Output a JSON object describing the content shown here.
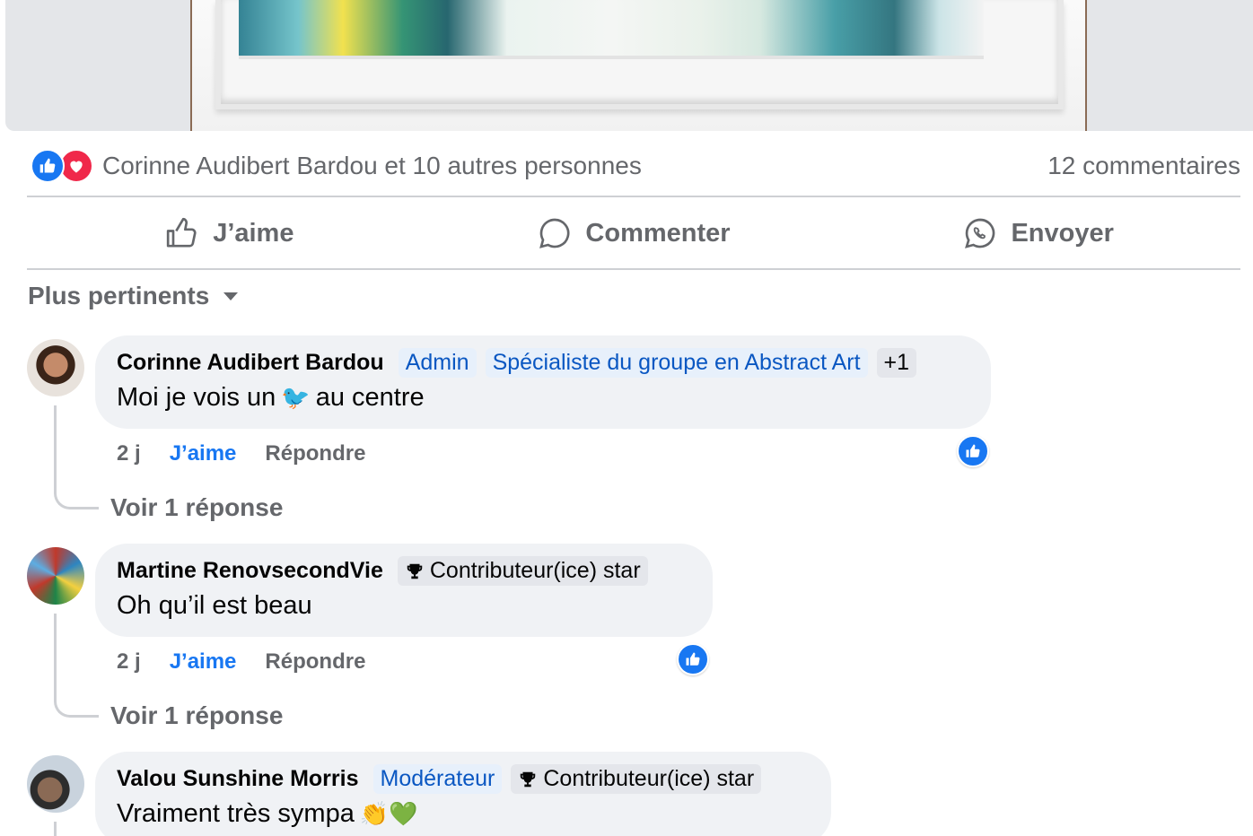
{
  "reactions_summary": {
    "names_text": "Corinne Audibert Bardou et 10 autres personnes",
    "comments_count": "12 commentaires",
    "icons": [
      "like-icon",
      "love-icon"
    ]
  },
  "actions": {
    "like": "J’aime",
    "comment": "Commenter",
    "send": "Envoyer"
  },
  "sort": {
    "label": "Plus pertinents"
  },
  "comments": [
    {
      "author": "Corinne Audibert Bardou",
      "badges": [
        "Admin",
        "Spécialiste du groupe en Abstract Art"
      ],
      "extra_badge": "+1",
      "text_before": "Moi je vois un",
      "emoji": "🐦",
      "text_after": "au centre",
      "time": "2 j",
      "like_label": "J’aime",
      "reply_label": "Répondre",
      "view_replies": "Voir 1 réponse"
    },
    {
      "author": "Martine RenovsecondVie",
      "star_badge": "Contributeur(ice) star",
      "text": "Oh qu’il est beau",
      "time": "2 j",
      "like_label": "J’aime",
      "reply_label": "Répondre",
      "view_replies": "Voir 1 réponse"
    },
    {
      "author": "Valou Sunshine Morris",
      "badges": [
        "Modérateur"
      ],
      "star_badge": "Contributeur(ice) star",
      "text": "Vraiment très sympa",
      "emoji": "👏💚"
    }
  ],
  "colors": {
    "accent": "#1877f2",
    "love": "#f0284a",
    "secondary_text": "#65676b",
    "bubble_bg": "#f0f2f5"
  }
}
